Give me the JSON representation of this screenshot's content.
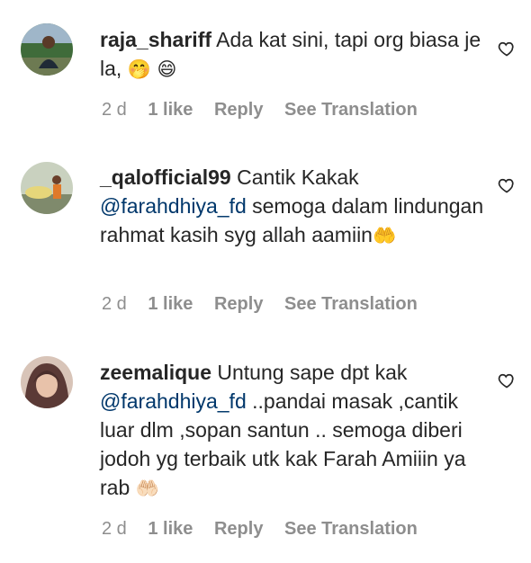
{
  "comments": [
    {
      "username": "raja_shariff",
      "text": "Ada kat sini, tapi org biasa je la, ",
      "mention": "",
      "text_after_mention": "",
      "emojis": "🤭 😄",
      "time": "2 d",
      "likes": "1 like",
      "reply_label": "Reply",
      "translate_label": "See Translation"
    },
    {
      "username": "_qalofficial99",
      "text": "Cantik Kakak",
      "mention": "@farahdhiya_fd",
      "text_after_mention": "semoga dalam lindungan rahmat kasih syg allah aamiin",
      "emojis": "🤲",
      "time": "2 d",
      "likes": "1 like",
      "reply_label": "Reply",
      "translate_label": "See Translation"
    },
    {
      "username": "zeemalique",
      "text": "Untung sape dpt kak",
      "mention": "@farahdhiya_fd",
      "text_after_mention": "..pandai masak ,cantik luar dlm ,sopan santun .. semoga diberi jodoh yg terbaik utk kak Farah Amiiin ya rab",
      "emojis": "🤲🏻",
      "time": "2 d",
      "likes": "1 like",
      "reply_label": "Reply",
      "translate_label": "See Translation"
    }
  ],
  "colors": {
    "text": "#262626",
    "mention": "#00376b",
    "meta": "#8e8e8e"
  }
}
